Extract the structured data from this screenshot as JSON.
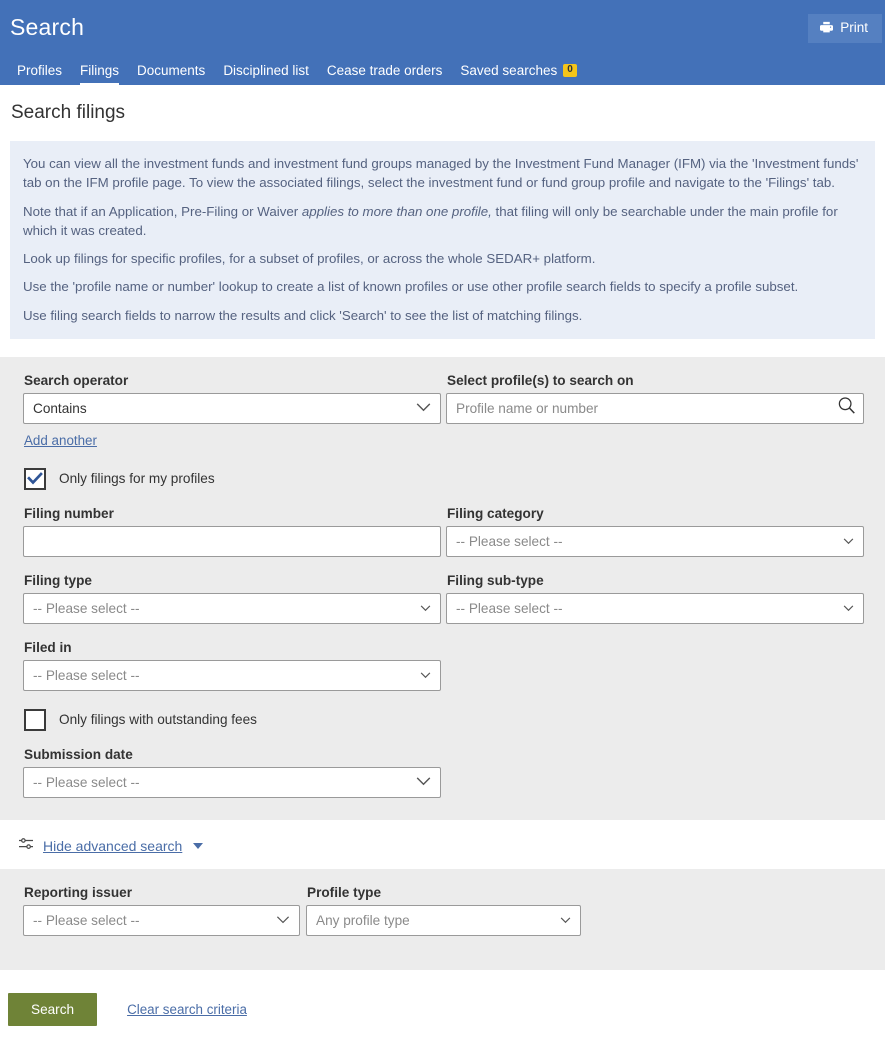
{
  "header": {
    "title": "Search",
    "print_label": "Print",
    "print_icon": "printer-icon",
    "nav": [
      {
        "label": "Profiles",
        "active": false
      },
      {
        "label": "Filings",
        "active": true
      },
      {
        "label": "Documents",
        "active": false
      },
      {
        "label": "Disciplined list",
        "active": false
      },
      {
        "label": "Cease trade orders",
        "active": false
      },
      {
        "label": "Saved searches",
        "active": false,
        "badge": "0"
      }
    ],
    "colors": {
      "bar": "#4371b8",
      "print_button": "#5580c1",
      "badge": "#f5c518"
    }
  },
  "page": {
    "title": "Search filings"
  },
  "info": {
    "paragraphs": [
      "You can view all the investment funds and investment fund groups managed by the Investment Fund Manager (IFM) via the 'Investment funds' tab on the IFM profile page. To view the associated filings, select the investment fund or fund group profile and navigate to the 'Filings' tab.",
      "Look up filings for specific profiles, for a subset of profiles, or across the whole SEDAR+ platform.",
      "Use the 'profile name or number' lookup to create a list of known profiles or use other profile search fields to specify a profile subset.",
      "Use filing search fields to narrow the results and click 'Search' to see the list of matching filings."
    ],
    "note_prefix": "Note that if an Application, Pre-Filing or Waiver ",
    "note_italic": "applies to more than one profile,",
    "note_suffix": " that filing will only be searchable under the main profile for which it was created."
  },
  "form": {
    "search_operator": {
      "label": "Search operator",
      "value": "Contains"
    },
    "add_another": "Add another",
    "select_profiles": {
      "label": "Select profile(s) to search on",
      "placeholder": "Profile name or number",
      "value": "",
      "icon": "magnifier-icon"
    },
    "only_my_profiles": {
      "label": "Only filings for my profiles",
      "checked": true
    },
    "filing_number": {
      "label": "Filing number",
      "value": ""
    },
    "filing_category": {
      "label": "Filing category",
      "value": "-- Please select --"
    },
    "filing_type": {
      "label": "Filing type",
      "value": "-- Please select --"
    },
    "filing_subtype": {
      "label": "Filing sub-type",
      "value": "-- Please select --"
    },
    "filed_in": {
      "label": "Filed in",
      "value": "-- Please select --"
    },
    "outstanding_fees": {
      "label": "Only filings with outstanding fees",
      "checked": false
    },
    "submission_date": {
      "label": "Submission date",
      "value": "-- Please select --"
    }
  },
  "advanced": {
    "toggle_label": "Hide advanced search",
    "toggle_icon": "sliders-icon",
    "caret_icon": "caret-down-icon",
    "reporting_issuer": {
      "label": "Reporting issuer",
      "value": "-- Please select --"
    },
    "profile_type": {
      "label": "Profile type",
      "value": "Any profile type"
    }
  },
  "actions": {
    "search_label": "Search",
    "clear_label": "Clear search criteria",
    "search_color": "#6f8337"
  }
}
